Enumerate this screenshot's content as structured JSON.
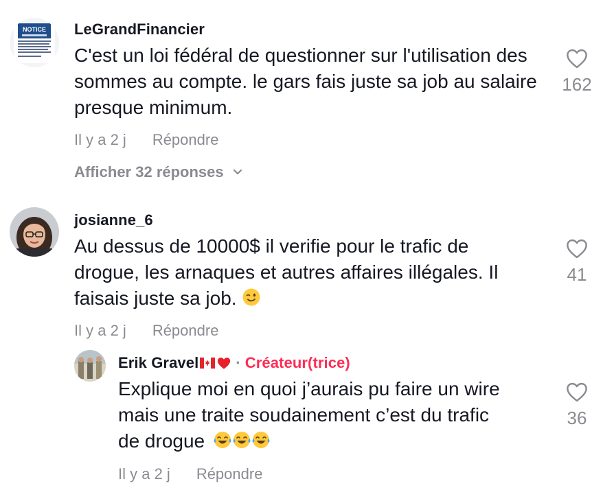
{
  "comments": [
    {
      "username": "LeGrandFinancier",
      "avatar_text": "NOTICE",
      "text": "C'est un loi fédéral de questionner sur l'utilisation des sommes au compte. le gars fais juste sa job au salaire presque minimum.",
      "time": "Il y a 2 j",
      "reply_label": "Répondre",
      "likes": "162",
      "view_replies": "Afficher 32 réponses"
    },
    {
      "username": "josianne_6",
      "text_line1": "Au dessus de 10000$ il verifie pour le trafic de",
      "text_line2": "drogue, les arnaques et autres affaires illégales. Il",
      "text_line3": "faisais juste sa job.",
      "time": "Il y a 2 j",
      "reply_label": "Répondre",
      "likes": "41"
    }
  ],
  "reply": {
    "username": "Erik Gravel",
    "separator": "·",
    "creator_label": "Créateur(trice)",
    "text_line1": "Explique moi en quoi j’aurais pu faire un wire",
    "text_line2": "mais une traite soudainement c’est du trafic",
    "text_line3": "de drogue",
    "time": "Il y a 2 j",
    "reply_label": "Répondre",
    "likes": "36"
  },
  "colors": {
    "text": "#161823",
    "muted": "#8a8b91",
    "creator": "#fe2c55"
  },
  "icons": [
    "heart-outline-icon",
    "chevron-down-icon",
    "winking-face-emoji",
    "tears-of-joy-emoji",
    "canada-flag-emoji",
    "red-heart-emoji"
  ]
}
